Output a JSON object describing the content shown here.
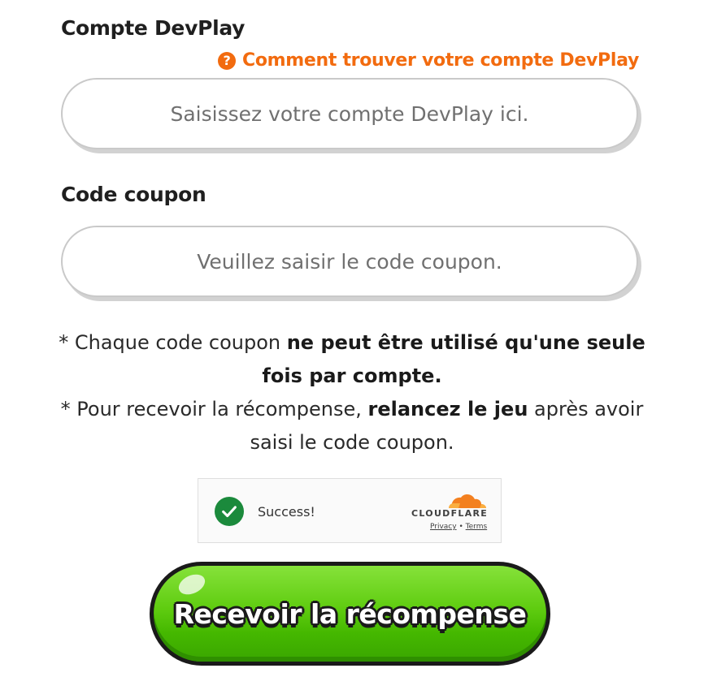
{
  "account": {
    "label": "Compte DevPlay",
    "help_link": "Comment trouver votre compte DevPlay",
    "placeholder": "Saisissez votre compte DevPlay ici."
  },
  "coupon": {
    "label": "Code coupon",
    "placeholder": "Veuillez saisir le code coupon."
  },
  "notes": {
    "line1_prefix": "* Chaque code coupon ",
    "line1_bold": "ne peut être utilisé qu'une seule fois par compte.",
    "line2_prefix": "* Pour recevoir la récompense, ",
    "line2_bold": "relancez le jeu",
    "line2_suffix": " après avoir saisi le code coupon."
  },
  "captcha": {
    "status": "Success!",
    "brand": "CLOUDFLARE",
    "privacy": "Privacy",
    "separator": "•",
    "terms": "Terms",
    "success_color": "#1b8a3c",
    "brand_color": "#f38020"
  },
  "submit": {
    "label": "Recevoir la récompense"
  },
  "colors": {
    "accent": "#f26b0f",
    "button_green": "#5fcc10"
  }
}
